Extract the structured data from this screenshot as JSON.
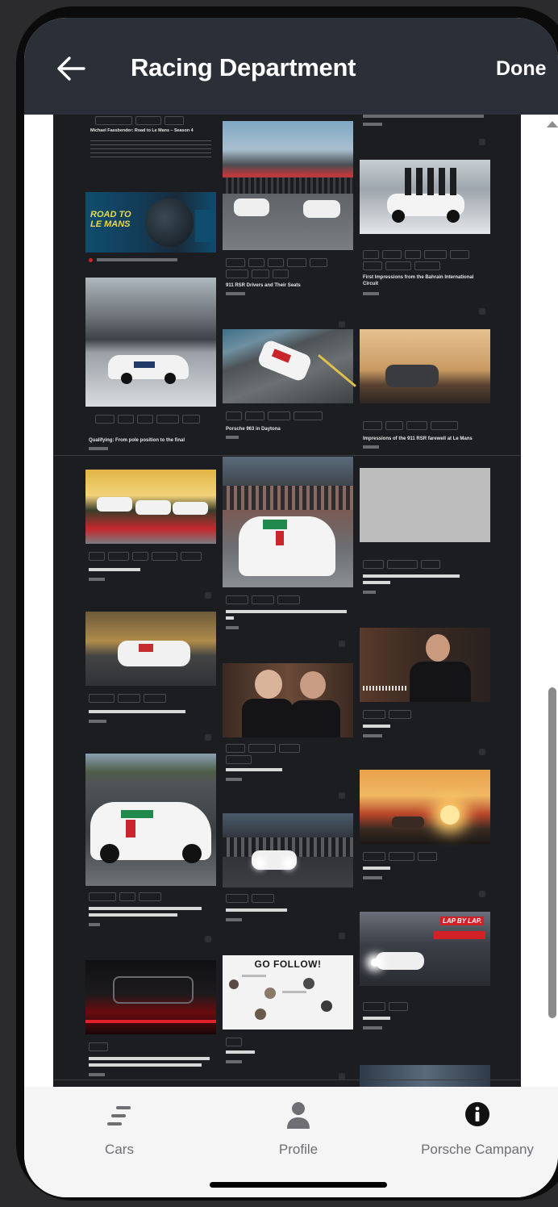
{
  "header": {
    "title": "Racing Department",
    "done_label": "Done",
    "back_icon": "arrow-left-icon"
  },
  "feed": {
    "top_cards": [
      {
        "title": "Michael Fassbender: Road to Le Mans – Season 4",
        "image_text": "ROAD TO LE MANS"
      },
      {
        "title": "911 RSR Drivers and Their Seats"
      },
      {
        "title": "First Impressions from the Bahrain International Circuit"
      },
      {
        "title": "Qualifying: From pole position to the final"
      },
      {
        "title": "Porsche 963 in Daytona"
      },
      {
        "title": "Impressions of the 911 RSR farewell at Le Mans"
      }
    ],
    "promo_banner": {
      "title": "GO FOLLOW!"
    },
    "lap_badge": "LAP BY LAP."
  },
  "bottom_nav": {
    "items": [
      {
        "label": "Cars",
        "icon": "car-list-icon"
      },
      {
        "label": "Profile",
        "icon": "person-icon"
      },
      {
        "label": "Porsche Campany",
        "icon": "info-icon"
      }
    ]
  },
  "colors": {
    "appbar": "#2a2f38",
    "feed_background": "#1c1d20",
    "accent_red": "#d22228"
  }
}
